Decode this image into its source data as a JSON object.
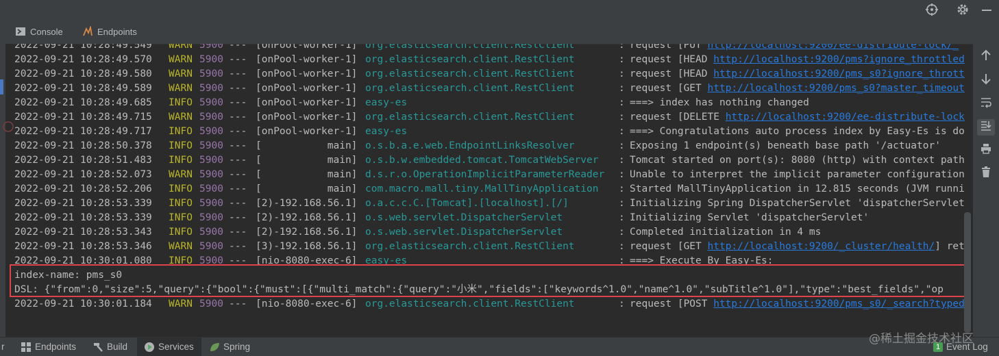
{
  "tabs": {
    "console": "Console",
    "endpoints": "Endpoints"
  },
  "log_lines": [
    {
      "date": "2022-09-21 10:28:49.549",
      "level": "WARN",
      "pid": "5900",
      "sep": "---",
      "thread": "[onPool-worker-1]",
      "logger": "org.elasticsearch.client.RestClient",
      "colon": ":",
      "msg": "request [PUT ",
      "link": "http://localhost:9200/ee-distribute-lock/_",
      "rest": ""
    },
    {
      "date": "2022-09-21 10:28:49.570",
      "level": "WARN",
      "pid": "5900",
      "sep": "---",
      "thread": "[onPool-worker-1]",
      "logger": "org.elasticsearch.client.RestClient",
      "colon": ":",
      "msg": "request [HEAD ",
      "link": "http://localhost:9200/pms?ignore_throttled",
      "rest": ""
    },
    {
      "date": "2022-09-21 10:28:49.580",
      "level": "WARN",
      "pid": "5900",
      "sep": "---",
      "thread": "[onPool-worker-1]",
      "logger": "org.elasticsearch.client.RestClient",
      "colon": ":",
      "msg": "request [HEAD ",
      "link": "http://localhost:9200/pms_s0?ignore_thrott",
      "rest": ""
    },
    {
      "date": "2022-09-21 10:28:49.589",
      "level": "WARN",
      "pid": "5900",
      "sep": "---",
      "thread": "[onPool-worker-1]",
      "logger": "org.elasticsearch.client.RestClient",
      "colon": ":",
      "msg": "request [GET ",
      "link": "http://localhost:9200/pms_s0?master_timeout",
      "rest": ""
    },
    {
      "date": "2022-09-21 10:28:49.685",
      "level": "INFO",
      "pid": "5900",
      "sep": "---",
      "thread": "[onPool-worker-1]",
      "logger": "easy-es",
      "colon": ":",
      "msg": "===> index has nothing changed",
      "link": "",
      "rest": ""
    },
    {
      "date": "2022-09-21 10:28:49.715",
      "level": "WARN",
      "pid": "5900",
      "sep": "---",
      "thread": "[onPool-worker-1]",
      "logger": "org.elasticsearch.client.RestClient",
      "colon": ":",
      "msg": "request [DELETE ",
      "link": "http://localhost:9200/ee-distribute-lock",
      "rest": ""
    },
    {
      "date": "2022-09-21 10:28:49.717",
      "level": "INFO",
      "pid": "5900",
      "sep": "---",
      "thread": "[onPool-worker-1]",
      "logger": "easy-es",
      "colon": ":",
      "msg": "===> Congratulations auto process index by Easy-Es is do",
      "link": "",
      "rest": ""
    },
    {
      "date": "2022-09-21 10:28:50.378",
      "level": "INFO",
      "pid": "5900",
      "sep": "---",
      "thread": "[           main]",
      "logger": "o.s.b.a.e.web.EndpointLinksResolver",
      "colon": ":",
      "msg": "Exposing 1 endpoint(s) beneath base path '/actuator'",
      "link": "",
      "rest": ""
    },
    {
      "date": "2022-09-21 10:28:51.483",
      "level": "INFO",
      "pid": "5900",
      "sep": "---",
      "thread": "[           main]",
      "logger": "o.s.b.w.embedded.tomcat.TomcatWebServer",
      "colon": ":",
      "msg": "Tomcat started on port(s): 8080 (http) with context path",
      "link": "",
      "rest": ""
    },
    {
      "date": "2022-09-21 10:28:52.073",
      "level": "WARN",
      "pid": "5900",
      "sep": "---",
      "thread": "[           main]",
      "logger": "d.s.r.o.OperationImplicitParameterReader",
      "colon": ":",
      "msg": "Unable to interpret the implicit parameter configuration",
      "link": "",
      "rest": ""
    },
    {
      "date": "2022-09-21 10:28:52.206",
      "level": "INFO",
      "pid": "5900",
      "sep": "---",
      "thread": "[           main]",
      "logger": "com.macro.mall.tiny.MallTinyApplication",
      "colon": ":",
      "msg": "Started MallTinyApplication in 12.815 seconds (JVM runni",
      "link": "",
      "rest": ""
    },
    {
      "date": "2022-09-21 10:28:53.339",
      "level": "INFO",
      "pid": "5900",
      "sep": "---",
      "thread": "[2)-192.168.56.1]",
      "logger": "o.a.c.c.C.[Tomcat].[localhost].[/]",
      "colon": ":",
      "msg": "Initializing Spring DispatcherServlet 'dispatcherServlet",
      "link": "",
      "rest": ""
    },
    {
      "date": "2022-09-21 10:28:53.339",
      "level": "INFO",
      "pid": "5900",
      "sep": "---",
      "thread": "[2)-192.168.56.1]",
      "logger": "o.s.web.servlet.DispatcherServlet",
      "colon": ":",
      "msg": "Initializing Servlet 'dispatcherServlet'",
      "link": "",
      "rest": ""
    },
    {
      "date": "2022-09-21 10:28:53.343",
      "level": "INFO",
      "pid": "5900",
      "sep": "---",
      "thread": "[2)-192.168.56.1]",
      "logger": "o.s.web.servlet.DispatcherServlet",
      "colon": ":",
      "msg": "Completed initialization in 4 ms",
      "link": "",
      "rest": ""
    },
    {
      "date": "2022-09-21 10:28:53.346",
      "level": "WARN",
      "pid": "5900",
      "sep": "---",
      "thread": "[3)-192.168.56.1]",
      "logger": "org.elasticsearch.client.RestClient",
      "colon": ":",
      "msg": "request [GET ",
      "link": "http://localhost:9200/_cluster/health/",
      "rest": "] ret"
    },
    {
      "date": "2022-09-21 10:30:01.080",
      "level": "INFO",
      "pid": "5900",
      "sep": "---",
      "thread": "[nio-8080-exec-6]",
      "logger": "easy-es",
      "colon": ":",
      "msg": "===> Execute By Easy-Es:",
      "link": "",
      "rest": ""
    }
  ],
  "dsl_block": {
    "index_line": "index-name: pms_s0",
    "dsl_line": "DSL: {\"from\":0,\"size\":5,\"query\":{\"bool\":{\"must\":[{\"multi_match\":{\"query\":\"小米\",\"fields\":[\"keywords^1.0\",\"name^1.0\",\"subTitle^1.0\"],\"type\":\"best_fields\",\"op"
  },
  "last_line": {
    "date": "2022-09-21 10:30:01.184",
    "level": "WARN",
    "pid": "5900",
    "sep": "---",
    "thread": "[nio-8080-exec-6]",
    "logger": "org.elasticsearch.client.RestClient",
    "colon": ":",
    "msg": "request [POST ",
    "link": "http://localhost:9200/pms_s0/_search?typed",
    "rest": ""
  },
  "bottom_tabs": {
    "left_cut": "r",
    "endpoints": "Endpoints",
    "build": "Build",
    "services": "Services",
    "spring": "Spring",
    "event_log": "Event Log",
    "event_count": "1"
  },
  "watermark": "@稀土掘金技术社区",
  "colors": {
    "accent_red": "#e0434b",
    "link_blue": "#287bde",
    "logger_teal": "#299999",
    "level_yellow": "#bbb529",
    "pid_purple": "#9876aa"
  }
}
